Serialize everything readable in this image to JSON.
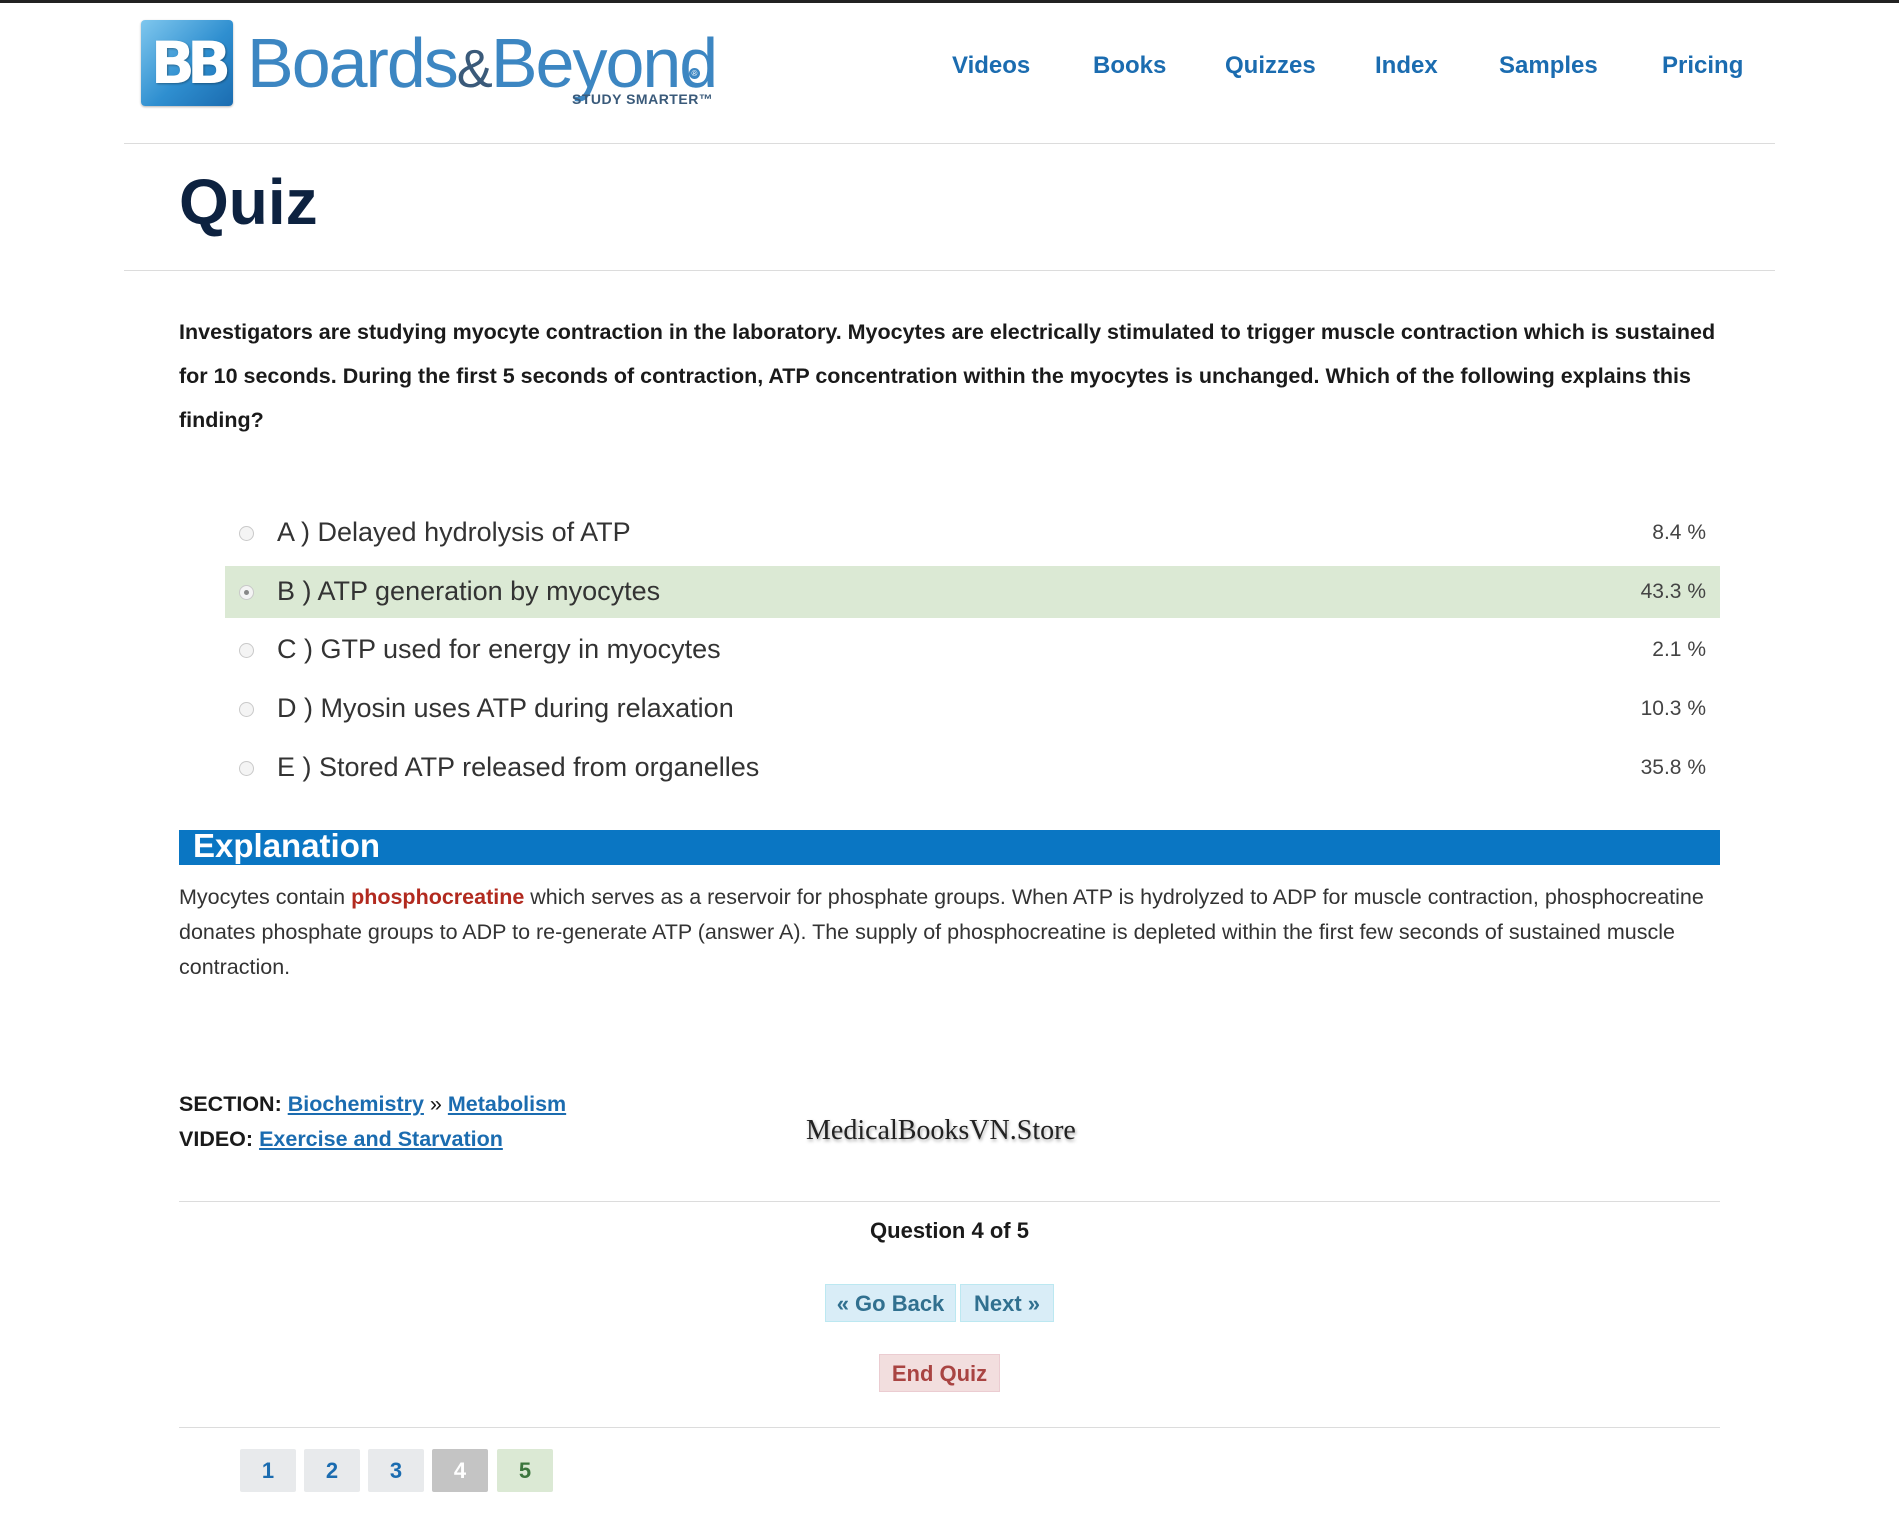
{
  "header": {
    "logo": {
      "badge": "BB",
      "word_left": "Boards",
      "amp": "&",
      "word_right": "Beyond",
      "tagline": "STUDY SMARTER™"
    },
    "nav": [
      "Videos",
      "Books",
      "Quizzes",
      "Index",
      "Samples",
      "Pricing"
    ]
  },
  "page": {
    "title": "Quiz"
  },
  "question": {
    "text": "Investigators are studying myocyte contraction in the laboratory. Myocytes are electrically stimulated to trigger muscle contraction which is sustained for 10 seconds. During the first 5 seconds of contraction, ATP concentration within the myocytes is unchanged. Which of the following explains this finding?"
  },
  "answers": [
    {
      "label": "A ) Delayed hydrolysis of ATP",
      "pct": "8.4 %",
      "selected": false
    },
    {
      "label": "B ) ATP generation by myocytes",
      "pct": "43.3 %",
      "selected": true
    },
    {
      "label": "C ) GTP used for energy in myocytes",
      "pct": "2.1 %",
      "selected": false
    },
    {
      "label": "D ) Myosin uses ATP during relaxation",
      "pct": "10.3 %",
      "selected": false
    },
    {
      "label": "E ) Stored ATP released from organelles",
      "pct": "35.8 %",
      "selected": false
    }
  ],
  "explanation": {
    "title": "Explanation",
    "before": "Myocytes contain ",
    "term": "phosphocreatine",
    "after": " which serves as a reservoir for phosphate groups. When ATP is hydrolyzed to ADP for muscle contraction, phosphocreatine donates phosphate groups to ADP to re-generate ATP (answer A). The supply of phosphocreatine is depleted within the first few seconds of sustained muscle contraction."
  },
  "meta": {
    "section_label": "SECTION:",
    "section_link1": "Biochemistry",
    "section_sep": "»",
    "section_link2": "Metabolism",
    "video_label": "VIDEO:",
    "video_link": "Exercise and Starvation"
  },
  "watermark": "MedicalBooksVN.Store",
  "navigation": {
    "counter": "Question 4 of 5",
    "back": "« Go Back",
    "next": "Next »",
    "end": "End Quiz"
  },
  "pagination": [
    {
      "label": "1",
      "state": "default"
    },
    {
      "label": "2",
      "state": "default"
    },
    {
      "label": "3",
      "state": "default"
    },
    {
      "label": "4",
      "state": "current"
    },
    {
      "label": "5",
      "state": "correct"
    }
  ],
  "colors": {
    "brand_blue": "#1b6cb0",
    "explanation_bar": "#0a76c3",
    "selected_answer_bg": "#dbe9d4",
    "term_red": "#b22a1f"
  }
}
